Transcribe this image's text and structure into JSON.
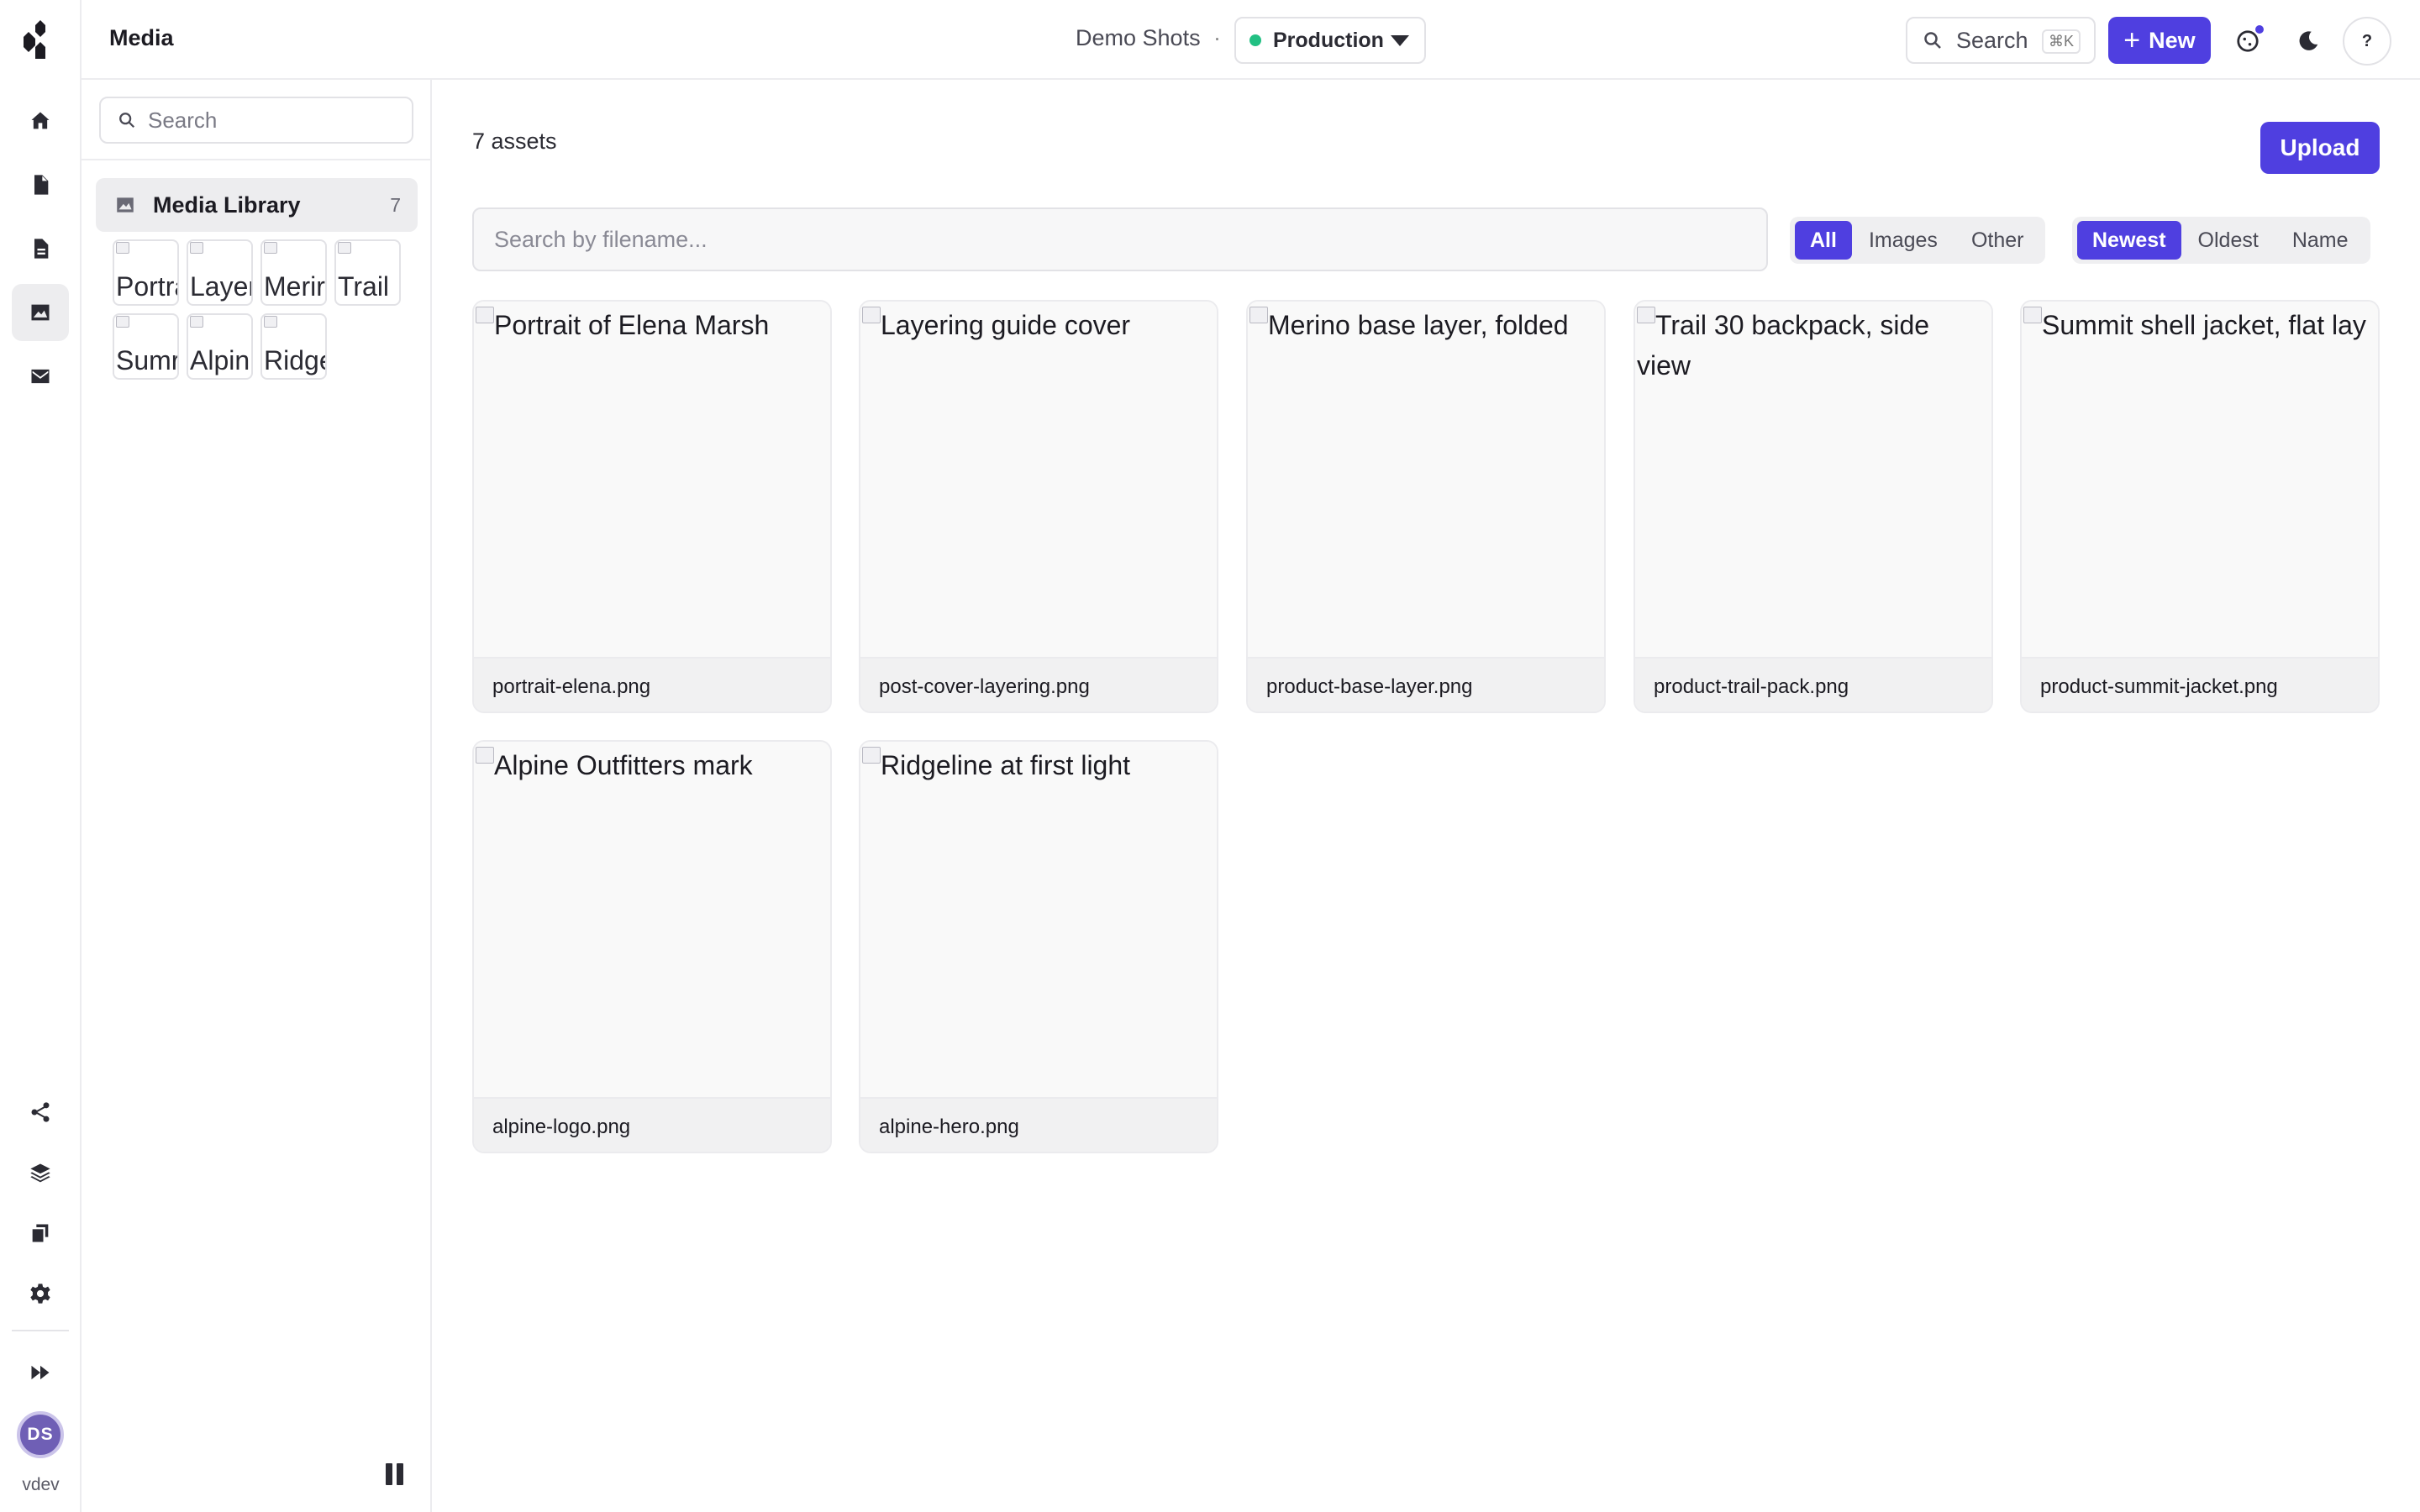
{
  "topbar": {
    "section_title": "Media",
    "project_name": "Demo Shots",
    "separator": "·",
    "environment": {
      "label": "Production",
      "status_color": "#22c083"
    },
    "search_label": "Search",
    "search_shortcut": "⌘K",
    "new_button_label": "New"
  },
  "rail": {
    "items": [
      "home-icon",
      "document-icon",
      "page-icon",
      "media-icon",
      "mail-icon"
    ],
    "bottom_items": [
      "share-icon",
      "layers-icon",
      "copy-icon",
      "settings-icon",
      "fast-forward-icon"
    ],
    "user": {
      "initials": "DS",
      "name": "vdev"
    }
  },
  "sidebar": {
    "search_placeholder": "Search",
    "library": {
      "label": "Media Library",
      "count": "7"
    },
    "thumbs": [
      "Portra",
      "Layer",
      "Merir",
      "Trail",
      "Sumr",
      "Alpin",
      "Ridge"
    ]
  },
  "main": {
    "asset_count": "7 assets",
    "upload_label": "Upload",
    "filter_placeholder": "Search by filename...",
    "type_filters": [
      "All",
      "Images",
      "Other"
    ],
    "type_filter_selected": "All",
    "sort_options": [
      "Newest",
      "Oldest",
      "Name"
    ],
    "sort_selected": "Newest",
    "assets": [
      {
        "alt": "Portrait of Elena Marsh",
        "filename": "portrait-elena.png"
      },
      {
        "alt": "Layering guide cover",
        "filename": "post-cover-layering.png"
      },
      {
        "alt": "Merino base layer, folded",
        "filename": "product-base-layer.png"
      },
      {
        "alt": "Trail 30 backpack, side view",
        "filename": "product-trail-pack.png"
      },
      {
        "alt": "Summit shell jacket, flat lay",
        "filename": "product-summit-jacket.png"
      },
      {
        "alt": "Alpine Outfitters mark",
        "filename": "alpine-logo.png"
      },
      {
        "alt": "Ridgeline at first light",
        "filename": "alpine-hero.png"
      }
    ]
  },
  "colors": {
    "accent": "#4f3fe0",
    "status_green": "#22c083"
  }
}
